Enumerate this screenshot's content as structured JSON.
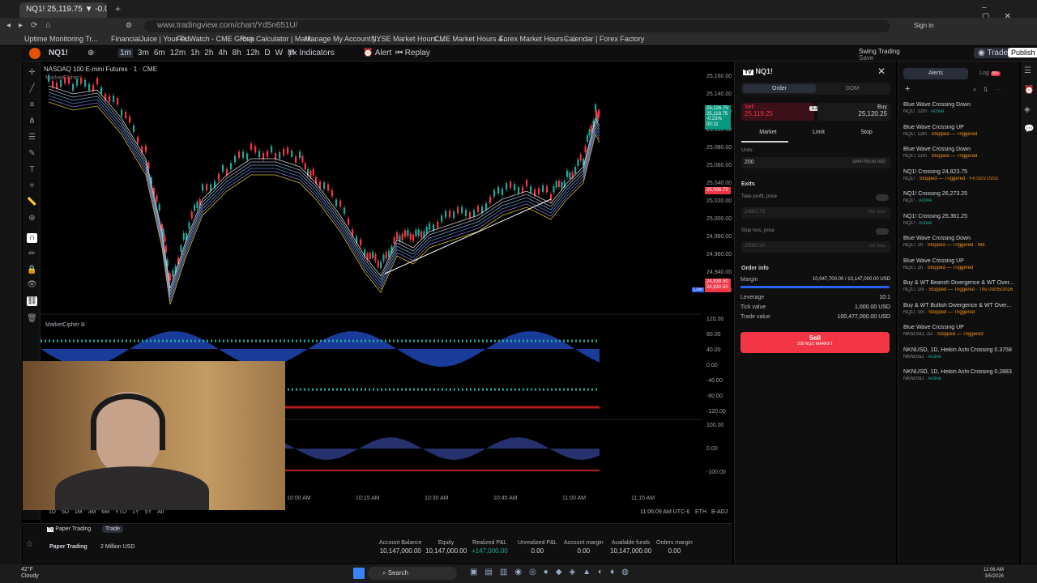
{
  "browser": {
    "tabs": [
      "NQ1! 25,119.75 ▼ -0.07% Swin"
    ],
    "url": "www.tradingview.com/chart/Yd5n651U/",
    "bookmarks": [
      "Uptime Monitoring Tr...",
      "FinancialJuice | Your Fi...",
      "FedWatch - CME Group",
      "Risk Calculator | Mark...",
      "Manage My Account |...",
      "NYSE Market Hours ...",
      "CME Market Hours &...",
      "Forex Market Hours - ...",
      "Calendar | Forex Factory"
    ],
    "signin": "Sign in"
  },
  "toolbar": {
    "symbol": "NQ1!",
    "timeframes": [
      "1m",
      "3m",
      "6m",
      "12m",
      "1h",
      "2h",
      "4h",
      "8h",
      "12h",
      "D",
      "W",
      "M"
    ],
    "indicators": "Indicators",
    "alert": "Alert",
    "replay": "Replay",
    "layout": "Swing Trading",
    "layout_sub": "Save",
    "trade": "Trade",
    "publish": "Publish"
  },
  "chart": {
    "legend": "NASDAQ 100 E-mini Futures · 1 · CME",
    "legend_sub": "MarketCipher",
    "prices": [
      "25,160.00",
      "25,140.00",
      "25,120.00",
      "25,100.00",
      "25,080.00",
      "25,060.00",
      "25,040.00",
      "25,020.00",
      "25,000.00",
      "24,980.00",
      "24,960.00",
      "24,940.00",
      "24,920.00"
    ],
    "last_price": "25,126.75",
    "last_price2": "25,118.75",
    "last_change": "-0.21%",
    "countdown": "00:11",
    "red_tag": "25,036.75",
    "low_label": "Low",
    "low_tag": "24,938.50",
    "low_tag2": "24,930.50",
    "indicator_name": "MarketCipher B",
    "ind_axis1": [
      "120.00",
      "80.00",
      "40.00",
      "0.00",
      "-40.00",
      "-80.00",
      "-120.00"
    ],
    "ind_axis2": [
      "100.00",
      "0.00",
      "-100.00"
    ],
    "times": [
      "10:00 AM",
      "10:15 AM",
      "10:30 AM",
      "10:45 AM",
      "11:00 AM",
      "11:15 AM"
    ],
    "ranges": [
      "1D",
      "5D",
      "1M",
      "3M",
      "6M",
      "YTD",
      "1Y",
      "5Y",
      "All"
    ],
    "clock": "11:06:09 AM UTC-6",
    "session": "ETH",
    "adj": "B-ADJ"
  },
  "order": {
    "symbol": "NQ1!",
    "tabs": [
      "Order",
      "DOM"
    ],
    "sell_label": "Sell",
    "sell_price": "25,119.25",
    "spread": "1.00",
    "buy_label": "Buy",
    "buy_price": "25,120.25",
    "types": [
      "Market",
      "Limit",
      "Stop"
    ],
    "units_label": "Units",
    "units": "200",
    "units_usd": "10047700.00 USD",
    "exits": "Exits",
    "tp_label": "Take profit, price",
    "tp_value": "24981.75",
    "tp_ticks": "501 Ticks",
    "sl_label": "Stop loss, price",
    "sl_value": "25082.00",
    "sl_ticks": "100 Ticks",
    "info_title": "Order info",
    "info": [
      {
        "k": "Margin",
        "v": "10,047,700.00 / 10,147,000.00 USD"
      },
      {
        "k": "Leverage",
        "v": "10:1"
      },
      {
        "k": "Tick value",
        "v": "1,000.00 USD"
      },
      {
        "k": "Trade value",
        "v": "100,477,000.00 USD"
      }
    ],
    "margin_fill": 0.99,
    "submit": "Sell",
    "submit_sub": "200 NQ1! MARKET"
  },
  "alerts": {
    "tabs": [
      "Alerts",
      "Log"
    ],
    "log_badge": "99+",
    "items": [
      {
        "title": "Blue Wave Crossing Down",
        "sub": "NQ1!, 12m",
        "status": "Active",
        "cls": "green"
      },
      {
        "title": "Blue Wave Crossing UP",
        "sub": "NQ1!, 12m",
        "status": "Stopped — Triggered",
        "cls": "orange"
      },
      {
        "title": "Blue Wave Crossing Down",
        "sub": "NQ1!, 12m",
        "status": "Stopped — Triggered",
        "cls": "orange"
      },
      {
        "title": "NQ1! Crossing 24,823.75",
        "sub": "NQ1!",
        "status": "Stopped — Triggered · Fri 02/27/202",
        "cls": "orange"
      },
      {
        "title": "NQ1! Crossing 26,273.25",
        "sub": "NQ1!",
        "status": "Active",
        "cls": "green"
      },
      {
        "title": "NQ1! Crossing 25,361.25",
        "sub": "NQ1!",
        "status": "Active",
        "cls": "green"
      },
      {
        "title": "Blue Wave Crossing Down",
        "sub": "NQ1!, 1h",
        "status": "Stopped — Triggered · We",
        "cls": "orange"
      },
      {
        "title": "Blue Wave Crossing UP",
        "sub": "NQ1!, 1h",
        "status": "Stopped — Triggered",
        "cls": "orange"
      },
      {
        "title": "Buy & WT Bearish Divergence & WT Over...",
        "sub": "NQ1!, 1m",
        "status": "Stopped — Triggered · Thu 03/05/2026",
        "cls": "orange"
      },
      {
        "title": "Buy & WT Bullish Divergence & WT Over...",
        "sub": "NQ1!, 1m",
        "status": "Stopped — Triggered",
        "cls": "orange"
      },
      {
        "title": "Blue Wave Crossing UP",
        "sub": "NKNUSD, 1D",
        "status": "Stopped — Triggered",
        "cls": "orange"
      },
      {
        "title": "NKNUSD, 1D, Heikin Ashi Crossing 0.3758",
        "sub": "NKNUSD",
        "status": "Active",
        "cls": "green"
      },
      {
        "title": "NKNUSD, 1D, Heikin Ashi Crossing 0.2883",
        "sub": "NKNUSD",
        "status": "Active",
        "cls": "green"
      }
    ]
  },
  "bottom": {
    "tabs": [
      "Paper Trading",
      "Trade"
    ],
    "account": "Paper Trading",
    "balance_sel": "2 Million USD",
    "fields": [
      {
        "k": "Account Balance",
        "v": "10,147,000.00"
      },
      {
        "k": "Equity",
        "v": "10,147,000.00"
      },
      {
        "k": "Realized P&L",
        "v": "+147,000.00"
      },
      {
        "k": "Unrealized P&L",
        "v": "0.00"
      },
      {
        "k": "Account margin",
        "v": "0.00"
      },
      {
        "k": "Available funds",
        "v": "10,147,000.00"
      },
      {
        "k": "Orders margin",
        "v": "0.00"
      }
    ]
  },
  "taskbar": {
    "weather": "42°F",
    "weather_sub": "Cloudy",
    "search": "Search",
    "time": "11:06 AM",
    "date": "3/5/2026"
  }
}
